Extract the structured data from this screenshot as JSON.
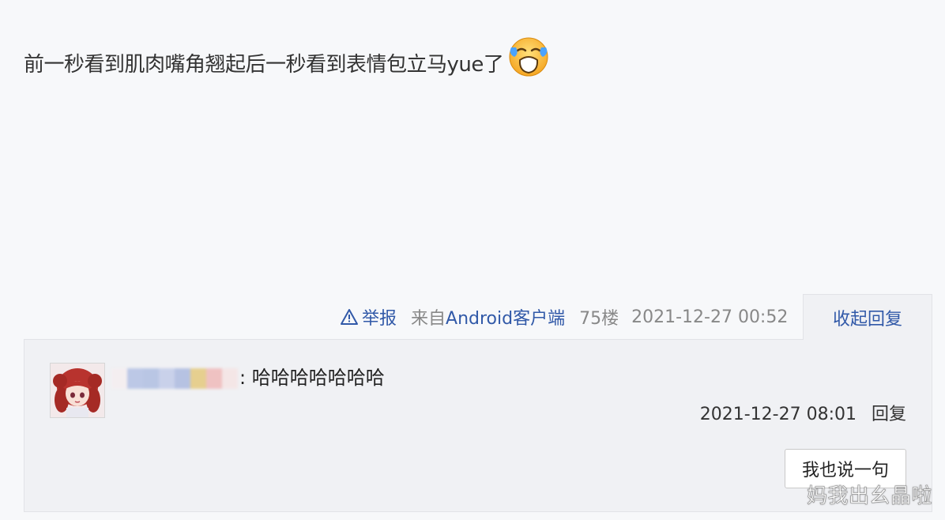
{
  "post": {
    "text": "前一秒看到肌肉嘴角翘起后一秒看到表情包立马yue了",
    "emoji_icon": "crying-face-icon"
  },
  "meta": {
    "report_label": "举报",
    "from_label": "来自",
    "client_label": "Android客户端",
    "floor": "75楼",
    "time": "2021-12-27 00:52",
    "collapse_label": "收起回复"
  },
  "reply": {
    "content": ": 哈哈哈哈哈哈哈",
    "time": "2021-12-27 08:01",
    "reply_label": "回复"
  },
  "compose": {
    "button_label": "我也说一句"
  },
  "watermark": {
    "text": "妈我出幺晶啦"
  },
  "colors": {
    "link": "#3159a8",
    "muted": "#888888",
    "panel_bg": "#f0f1f4",
    "page_bg": "#f7f8fa"
  }
}
